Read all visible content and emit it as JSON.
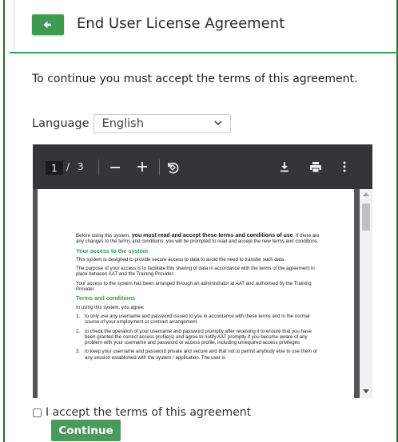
{
  "header": {
    "title": "End User License Agreement",
    "back_icon": "arrow-left-icon"
  },
  "intro": "To continue you must accept the terms of this agreement.",
  "language": {
    "label": "Language",
    "selected": "English"
  },
  "pdf_toolbar": {
    "current_page": "1",
    "separator": "/",
    "total_pages": "3",
    "icons": [
      "zoom-out-icon",
      "zoom-in-icon",
      "rotate-icon",
      "download-icon",
      "print-icon",
      "more-options-icon"
    ]
  },
  "document": {
    "lead_normal_1": "Before using this system, ",
    "lead_bold": "you must read and accept these terms and conditions of use",
    "lead_normal_2": ". If there are any changes to the terms and conditions, you will be prompted to read and accept the new terms and conditions.",
    "section_1_heading": "Your access to the system",
    "section_1_p1": "This system is designed to provide secure access to data to avoid the need to transfer such data.",
    "section_1_p2": "The purpose of your access is to facilitate this sharing of data in accordance with the terms of the agreement in place between AAT and the Training Provider.",
    "section_1_p3": "Your access to the system has been arranged through an administrator at AAT and authorised by the Training Provider.",
    "section_2_heading": "Terms and conditions",
    "section_2_intro": "In using this system, you agree:",
    "items": [
      {
        "num": "1.",
        "text": "to only use any username and password issued to you in accordance with these terms and in the normal course of your employment or contract arrangement"
      },
      {
        "num": "2.",
        "text": "to check the operation of your username and password promptly after receiving it to ensure that you have been granted the correct access profile(s) and agree to notify AAT promptly if you become aware of any problem with your username and password or access profile, including unrequired access privileges"
      },
      {
        "num": "3.",
        "text": "to keep your username and password private and secure and that not to permit anybody else to use them or any session established with the system / application. The user is"
      }
    ]
  },
  "accept": {
    "label": "I accept the terms of this agreement"
  },
  "continue_label": "Continue",
  "colors": {
    "brand_green": "#3f9a52",
    "pdf_toolbar": "#323639",
    "pdf_background": "#525659"
  }
}
